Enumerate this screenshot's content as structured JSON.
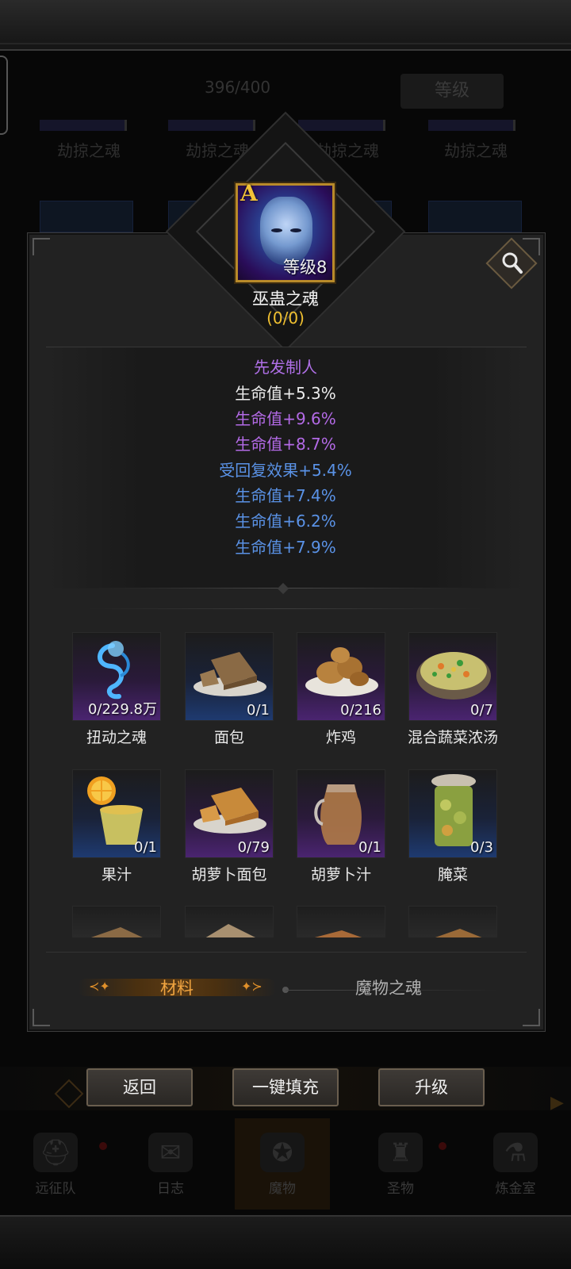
{
  "background": {
    "progress_text": "396/400",
    "level_button": "等级",
    "soul_labels": [
      "劫掠之魂",
      "劫掠之魂",
      "劫掠之魂",
      "劫掠之魂"
    ],
    "nav": [
      {
        "label": "远征队",
        "icon": "helmet-icon"
      },
      {
        "label": "日志",
        "icon": "scroll-icon"
      },
      {
        "label": "魔物",
        "icon": "beast-icon"
      },
      {
        "label": "圣物",
        "icon": "relic-icon"
      },
      {
        "label": "炼金室",
        "icon": "alchemy-icon"
      }
    ]
  },
  "soul": {
    "rank": "A",
    "level": "等级8",
    "name": "巫蛊之魂",
    "count": "(0/0)"
  },
  "stats": {
    "title": "先发制人",
    "lines": [
      {
        "text": "生命值+5.3%",
        "color": "#ececec"
      },
      {
        "text": "生命值+9.6%",
        "color": "#b36ae6"
      },
      {
        "text": "生命值+8.7%",
        "color": "#b36ae6"
      },
      {
        "text": "受回复效果+5.4%",
        "color": "#5a92e6"
      },
      {
        "text": "生命值+7.4%",
        "color": "#5a92e6"
      },
      {
        "text": "生命值+6.2%",
        "color": "#5a92e6"
      },
      {
        "text": "生命值+7.9%",
        "color": "#5a92e6"
      }
    ]
  },
  "materials": [
    {
      "name": "扭动之魂",
      "qty": "0/229.8万",
      "rarity": "purple",
      "icon": "spirit-wisp-icon"
    },
    {
      "name": "面包",
      "qty": "0/1",
      "rarity": "blue",
      "icon": "bread-icon"
    },
    {
      "name": "炸鸡",
      "qty": "0/216",
      "rarity": "purple",
      "icon": "fried-chicken-icon"
    },
    {
      "name": "混合蔬菜浓汤",
      "qty": "0/7",
      "rarity": "purple",
      "icon": "vegetable-soup-icon"
    },
    {
      "name": "果汁",
      "qty": "0/1",
      "rarity": "blue",
      "icon": "juice-icon"
    },
    {
      "name": "胡萝卜面包",
      "qty": "0/79",
      "rarity": "purple",
      "icon": "carrot-bread-icon"
    },
    {
      "name": "胡萝卜汁",
      "qty": "0/1",
      "rarity": "purple",
      "icon": "carrot-juice-icon"
    },
    {
      "name": "腌菜",
      "qty": "0/3",
      "rarity": "blue",
      "icon": "pickle-jar-icon"
    }
  ],
  "tabs": {
    "active": "材料",
    "inactive": "魔物之魂"
  },
  "buttons": {
    "back": "返回",
    "auto_fill": "一键填充",
    "upgrade": "升级"
  },
  "colors": {
    "accent_gold": "#f0c030",
    "tab_active": "#f0a440",
    "rarity_purple": "#4a2470",
    "rarity_blue": "#1e3a70"
  }
}
